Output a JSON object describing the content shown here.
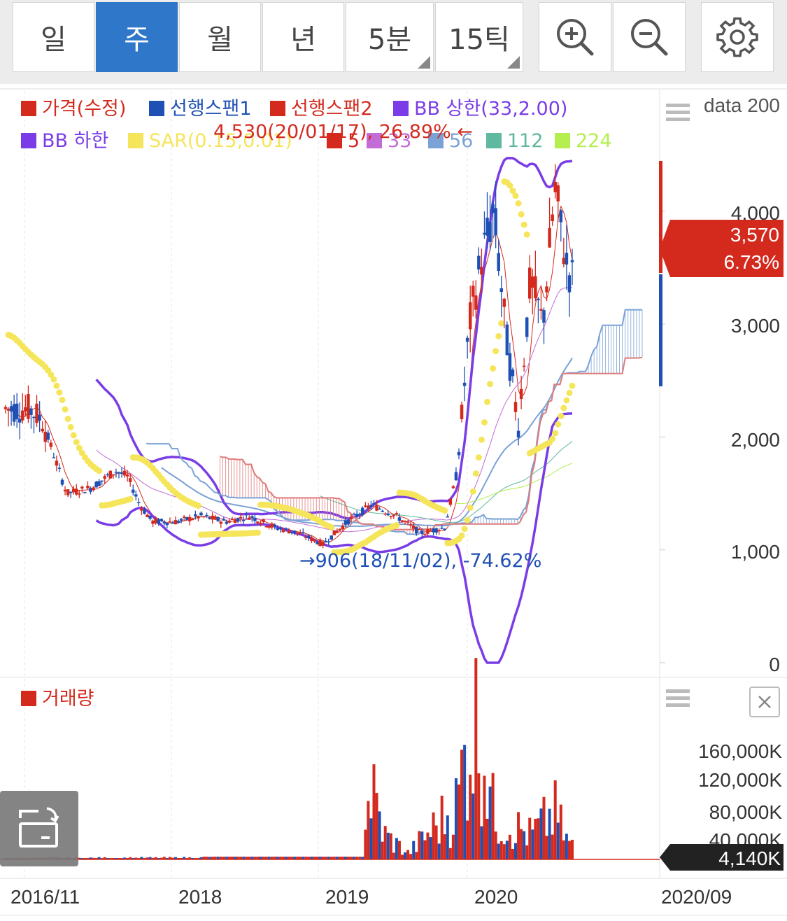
{
  "toolbar": {
    "periods": [
      {
        "label": "일",
        "active": false,
        "has_menu": false
      },
      {
        "label": "주",
        "active": true,
        "has_menu": false
      },
      {
        "label": "월",
        "active": false,
        "has_menu": false
      },
      {
        "label": "년",
        "active": false,
        "has_menu": false
      },
      {
        "label": "5분",
        "active": false,
        "has_menu": true
      },
      {
        "label": "15틱",
        "active": false,
        "has_menu": true
      }
    ],
    "icons": [
      "zoom-in-icon",
      "zoom-out-icon",
      "settings-gear-icon"
    ]
  },
  "rotate_icon": "rotate-screen-icon",
  "chart_data": [
    {
      "type": "candlestick",
      "title": "",
      "legend_placement": "top-left",
      "legend": [
        {
          "label": "가격(수정)",
          "color": "#d42a1e"
        },
        {
          "label": "선행스팬1",
          "color": "#1f50b4"
        },
        {
          "label": "선행스팬2",
          "color": "#d42a1e"
        },
        {
          "label": "BB 상한(33,2.00)",
          "color": "#7a3ce6"
        },
        {
          "label": "BB 하한",
          "color": "#7a3ce6"
        },
        {
          "label": "SAR(0.15,0.01)",
          "color": "#f5e55a"
        },
        {
          "label": "5",
          "color": "#d42a1e"
        },
        {
          "label": "33",
          "color": "#c36bd6"
        },
        {
          "label": "56",
          "color": "#7aa2d6"
        },
        {
          "label": "112",
          "color": "#5fb8a0"
        },
        {
          "label": "224",
          "color": "#b4ef4f"
        }
      ],
      "x_ticks": [
        "2016/11",
        "2018",
        "2019",
        "2020",
        "2020/09"
      ],
      "y_ticks": [
        "4,000",
        "3,000",
        "2,000",
        "1,000",
        "0"
      ],
      "ylim": [
        0,
        4600
      ],
      "grid": true,
      "scale_label": "data 200",
      "current_price": "3,570",
      "current_change": "6.73%",
      "annotations": [
        {
          "text": "4,530(20/01/17), 26.89% ←",
          "color": "#d42a1e"
        },
        {
          "text": "→906(18/11/02), -74.62%",
          "color": "#1f50b4"
        }
      ],
      "price_series": [
        {
          "x": "2016/11",
          "close": 2250
        },
        {
          "x": "2016/12",
          "close": 2150
        },
        {
          "x": "2017/02",
          "close": 1500
        },
        {
          "x": "2017/04",
          "close": 1550
        },
        {
          "x": "2017/06",
          "close": 1700
        },
        {
          "x": "2017/07",
          "close": 1650
        },
        {
          "x": "2017/08",
          "close": 1400
        },
        {
          "x": "2017/09",
          "close": 1250
        },
        {
          "x": "2017/11",
          "close": 1250
        },
        {
          "x": "2018/01",
          "close": 1300
        },
        {
          "x": "2018/03",
          "close": 1250
        },
        {
          "x": "2018/05",
          "close": 1300
        },
        {
          "x": "2018/07",
          "close": 1200
        },
        {
          "x": "2018/09",
          "close": 1150
        },
        {
          "x": "2018/11",
          "close": 1050
        },
        {
          "x": "2019/01",
          "close": 1250
        },
        {
          "x": "2019/03",
          "close": 1400
        },
        {
          "x": "2019/05",
          "close": 1300
        },
        {
          "x": "2019/07",
          "close": 1150
        },
        {
          "x": "2019/09",
          "close": 1200
        },
        {
          "x": "2019/10",
          "close": 1700
        },
        {
          "x": "2019/11",
          "close": 3000
        },
        {
          "x": "2019/12",
          "close": 3600
        },
        {
          "x": "2020/01",
          "close": 4000
        },
        {
          "x": "2020/02",
          "close": 2900
        },
        {
          "x": "2020/03",
          "close": 2100
        },
        {
          "x": "2020/04",
          "close": 3400
        },
        {
          "x": "2020/05",
          "close": 3000
        },
        {
          "x": "2020/06",
          "close": 4200
        },
        {
          "x": "2020/07",
          "close": 3500
        },
        {
          "x": "2020/08",
          "close": 3300
        },
        {
          "x": "2020/09",
          "close": 3570
        }
      ]
    },
    {
      "type": "bar",
      "legend": [
        {
          "label": "거래량",
          "color": "#d42a1e"
        }
      ],
      "y_ticks": [
        "160,000K",
        "120,000K",
        "80,000K",
        "40,000K"
      ],
      "ylim": [
        0,
        180000
      ],
      "current_volume": "4,140K",
      "volume_series": [
        {
          "x": "2016/11",
          "value": 2000
        },
        {
          "x": "2018/01",
          "value": 2500
        },
        {
          "x": "2019/02",
          "value": 55000
        },
        {
          "x": "2019/03",
          "value": 110000
        },
        {
          "x": "2019/04",
          "value": 40000
        },
        {
          "x": "2019/06",
          "value": 10000
        },
        {
          "x": "2019/10",
          "value": 90000
        },
        {
          "x": "2019/11",
          "value": 215000
        },
        {
          "x": "2019/12",
          "value": 215000
        },
        {
          "x": "2020/01",
          "value": 70000
        },
        {
          "x": "2020/02",
          "value": 60000
        },
        {
          "x": "2020/04",
          "value": 40000
        },
        {
          "x": "2020/06",
          "value": 75000
        },
        {
          "x": "2020/07",
          "value": 30000
        },
        {
          "x": "2020/09",
          "value": 4140
        }
      ]
    }
  ],
  "close_icon": "close-icon",
  "menu_icon": "menu-lines-icon"
}
